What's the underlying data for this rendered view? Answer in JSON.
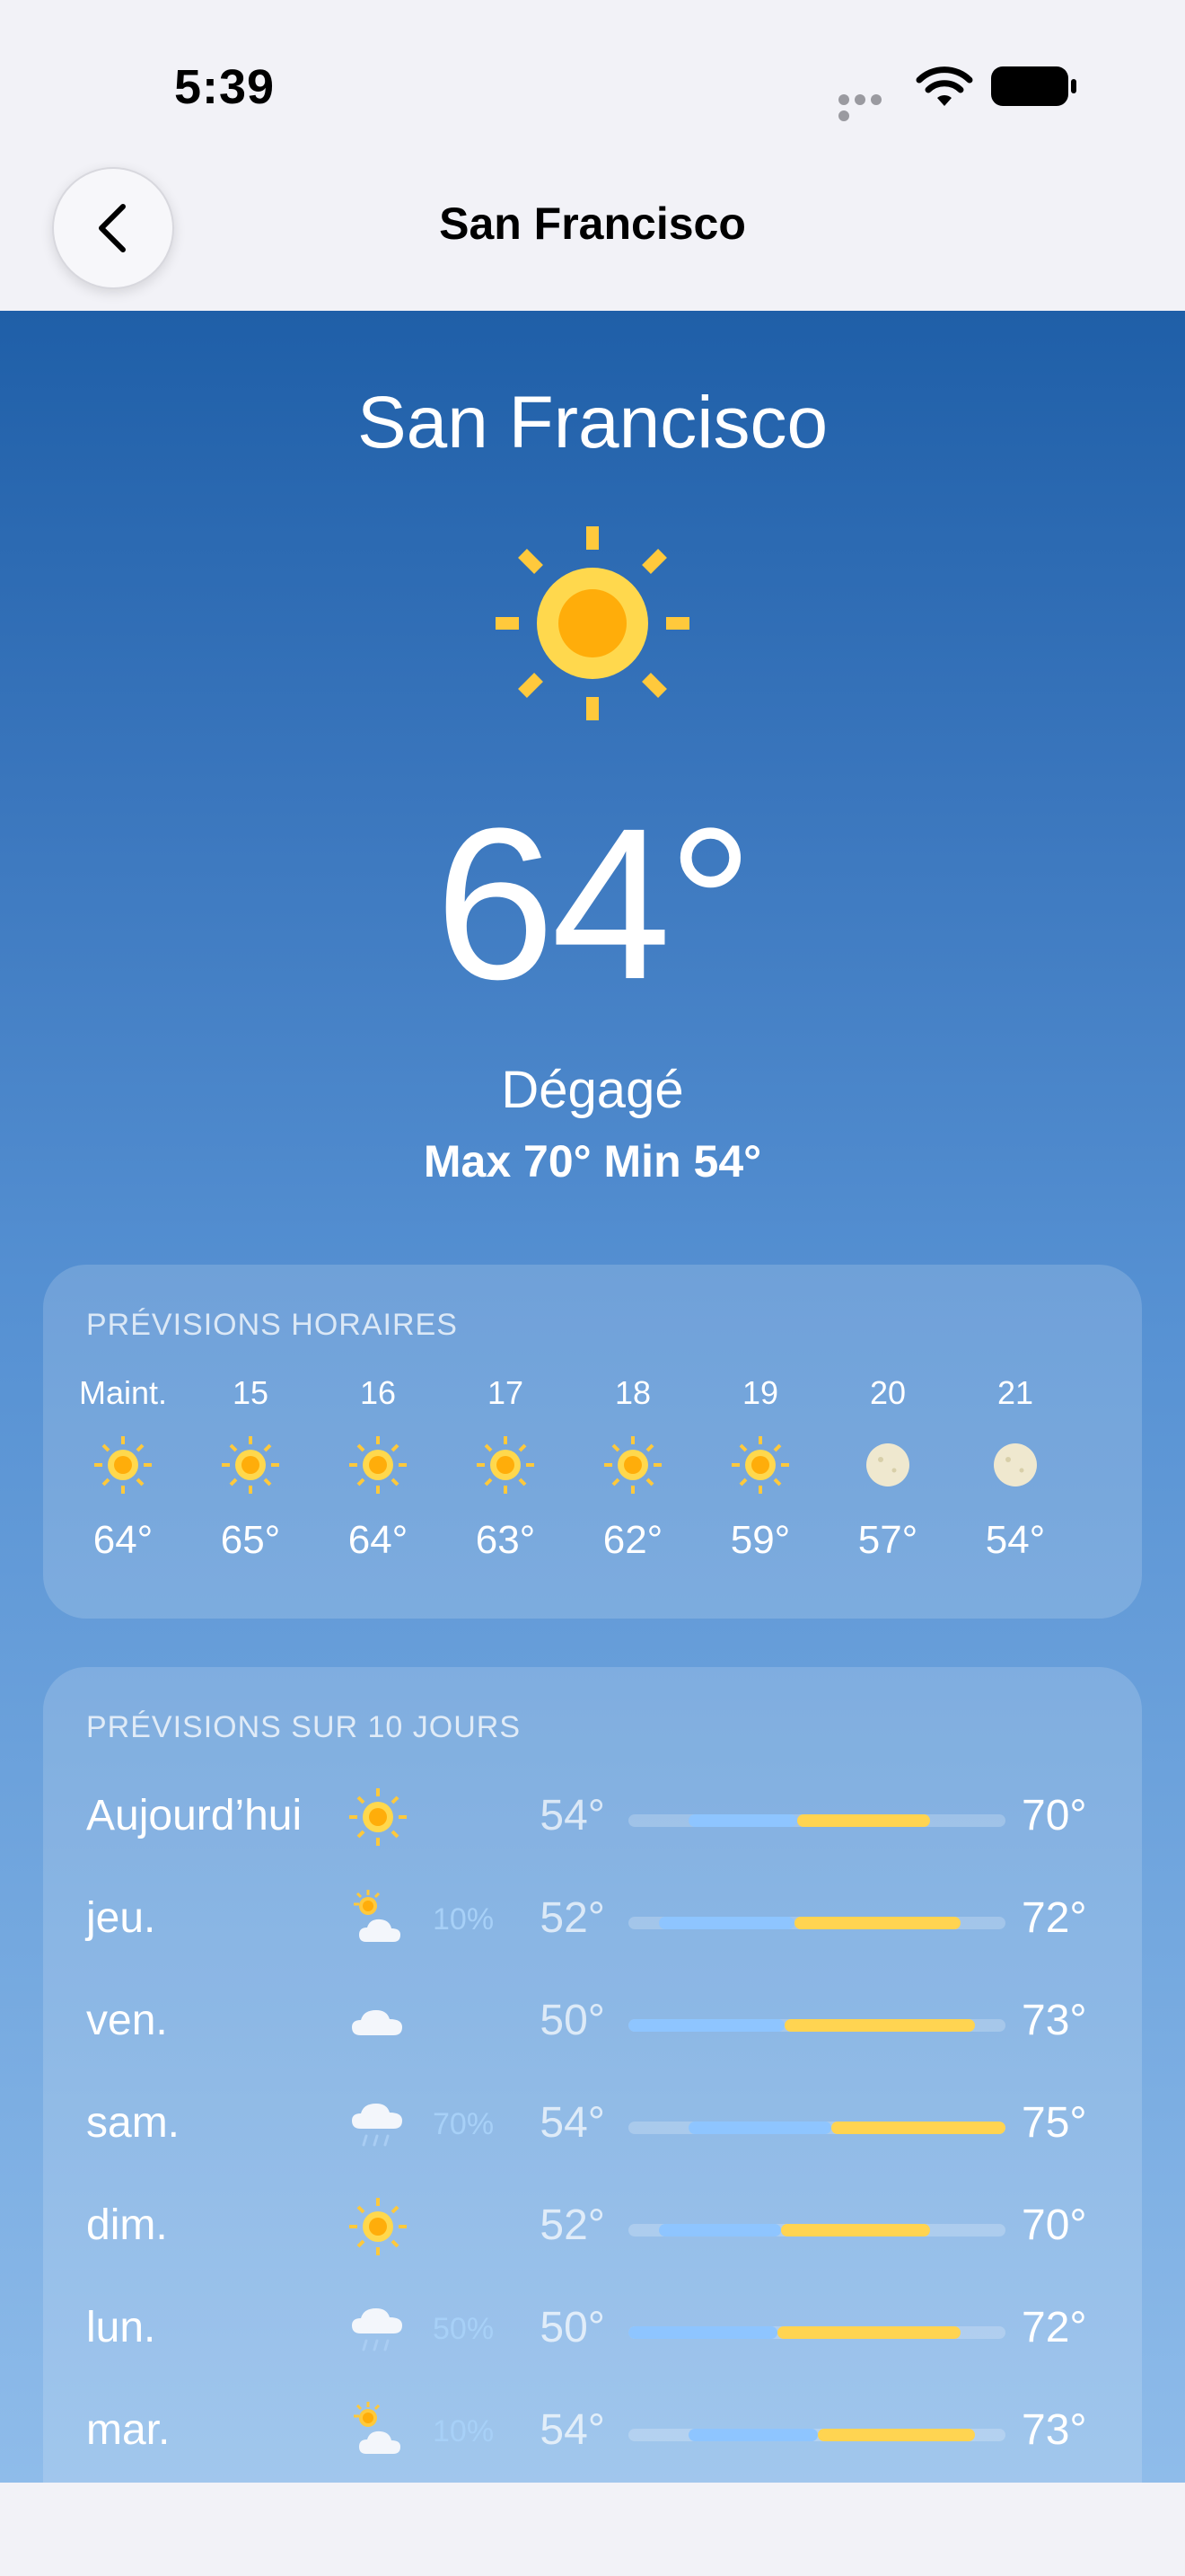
{
  "status": {
    "time": "5:39"
  },
  "nav": {
    "title": "San Francisco",
    "back_icon": "chevron-left-icon"
  },
  "current": {
    "city": "San Francisco",
    "icon": "sun-icon",
    "temperature": "64°",
    "condition": "Dégagé",
    "hilo": "Max 70° Min 54°"
  },
  "hourly": {
    "title": "PRÉVISIONS HORAIRES",
    "items": [
      {
        "label": "Maint.",
        "icon": "sun-icon",
        "temp": "64°"
      },
      {
        "label": "15",
        "icon": "sun-icon",
        "temp": "65°"
      },
      {
        "label": "16",
        "icon": "sun-icon",
        "temp": "64°"
      },
      {
        "label": "17",
        "icon": "sun-icon",
        "temp": "63°"
      },
      {
        "label": "18",
        "icon": "sun-icon",
        "temp": "62°"
      },
      {
        "label": "19",
        "icon": "sun-icon",
        "temp": "59°"
      },
      {
        "label": "20",
        "icon": "moon-icon",
        "temp": "57°"
      },
      {
        "label": "21",
        "icon": "moon-icon",
        "temp": "54°"
      }
    ]
  },
  "daily": {
    "title": "PRÉVISIONS SUR 10 JOURS",
    "range_min": 50,
    "range_max": 75,
    "days": [
      {
        "name": "Aujourd’hui",
        "icon": "sun-icon",
        "precip": "",
        "low": "54°",
        "high": "70°",
        "low_value": 54,
        "high_value": 70
      },
      {
        "name": "jeu.",
        "icon": "partly-cloudy-icon",
        "precip": "10%",
        "low": "52°",
        "high": "72°",
        "low_value": 52,
        "high_value": 72
      },
      {
        "name": "ven.",
        "icon": "cloud-icon",
        "precip": "",
        "low": "50°",
        "high": "73°",
        "low_value": 50,
        "high_value": 73
      },
      {
        "name": "sam.",
        "icon": "rain-icon",
        "precip": "70%",
        "low": "54°",
        "high": "75°",
        "low_value": 54,
        "high_value": 75
      },
      {
        "name": "dim.",
        "icon": "sun-icon",
        "precip": "",
        "low": "52°",
        "high": "70°",
        "low_value": 52,
        "high_value": 70
      },
      {
        "name": "lun.",
        "icon": "rain-icon",
        "precip": "50%",
        "low": "50°",
        "high": "72°",
        "low_value": 50,
        "high_value": 72
      },
      {
        "name": "mar.",
        "icon": "partly-cloudy-icon",
        "precip": "10%",
        "low": "54°",
        "high": "73°",
        "low_value": 54,
        "high_value": 73
      }
    ]
  },
  "colors": {
    "sun": "#ffc93c",
    "sun_core": "#ffad0a",
    "bar_cool": "#8ec5ff",
    "bar_warm": "#ffd451"
  }
}
